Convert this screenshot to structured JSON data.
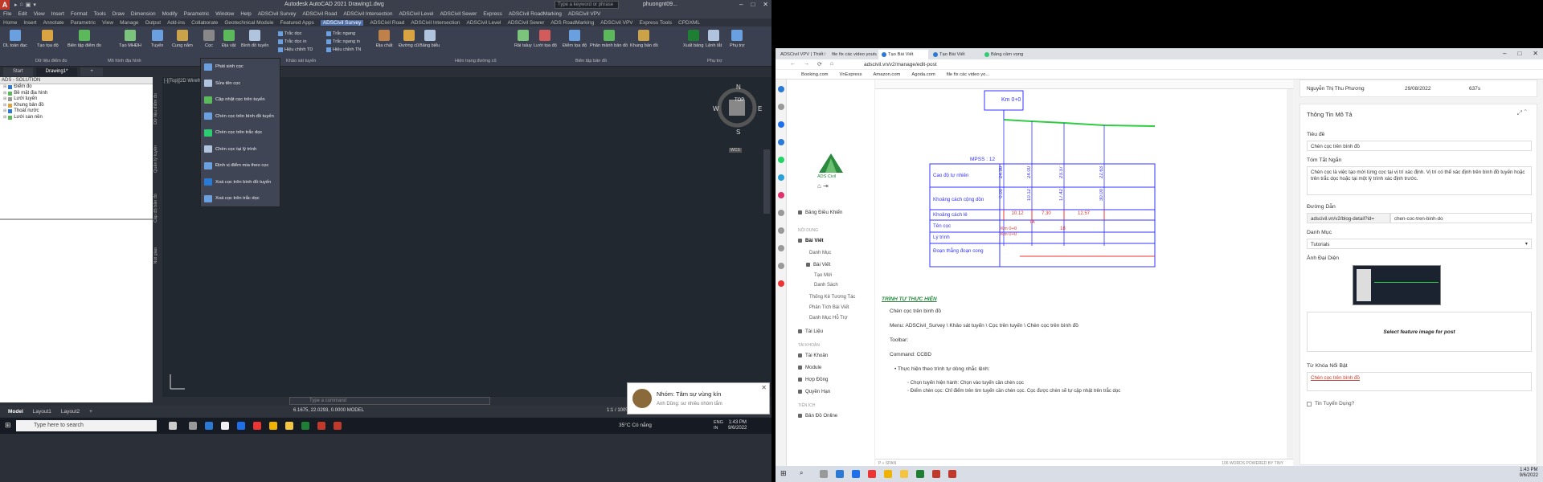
{
  "acad": {
    "qat": [
      "▸",
      "⌂",
      "▣",
      "▾"
    ],
    "window_title": "Autodesk AutoCAD 2021   Drawing1.dwg",
    "search_placeholder": "Type a keyword or phrase",
    "user": "phuongnt09...",
    "menubar": [
      "File",
      "Edit",
      "View",
      "Insert",
      "Format",
      "Tools",
      "Draw",
      "Dimension",
      "Modify",
      "Parametric",
      "Window",
      "Help",
      "ADSCivil Survey",
      "ADSCivil Road",
      "ADSCivil Intersection",
      "ADSCivil Level",
      "ADSCivil Sewer",
      "Express",
      "ADSCivil RoadMarking",
      "ADSCivil VPV"
    ],
    "tabs": [
      "Home",
      "Insert",
      "Annotate",
      "Parametric",
      "View",
      "Manage",
      "Output",
      "Add-ins",
      "Collaborate",
      "Geotechnical Module",
      "Featured Apps",
      "ADSCivil Survey",
      "ADSCivil Road",
      "ADSCivil Intersection",
      "ADSCivil Level",
      "ADSCivil Sewer",
      "ADS RoadMarking",
      "ADSCivil VPV",
      "Express Tools",
      "CPDXML"
    ],
    "active_tab": "ADSCivil Survey",
    "ribbon_buttons": [
      "DL toàn đạc",
      "Tạo tọa độ",
      "Biên tập điểm đo",
      "Tạo MHĐH",
      "Tuyến",
      "Cung nắm",
      "Cọc",
      "Địa vật",
      "Bình đồ tuyến",
      "Địa chất",
      "Đường cũ",
      "Bảng biểu",
      "Rải taluy",
      "Lưới tọa độ",
      "Điểm tọa độ",
      "Phân mảnh bản đồ",
      "Khung bản đồ",
      "Xuất bảng",
      "Lệnh tắt",
      "Phụ trợ"
    ],
    "ribbon_small": [
      "Trắc dọc",
      "Trắc dọc in",
      "Hiệu chỉnh TD",
      "Trắc ngang",
      "Trắc ngang in",
      "Hiệu chỉnh TN"
    ],
    "ribbon_panels": [
      "Dữ liệu điểm đo",
      "Mô hình địa hình",
      "Khảo sát tuyến",
      "Hiện trạng đường cũ",
      "Biên tập bản đồ",
      "Phụ trợ"
    ],
    "doc_tabs": [
      "Start",
      "Drawing1*"
    ],
    "panel_title": "ADS - SOLUTION",
    "tree": [
      "Điểm đo",
      "Bề mặt địa hình",
      "Lưới tuyến",
      "Khung bản đồ",
      "Thoát nước",
      "Lưới san nền"
    ],
    "vtabs": [
      "Dữ liệu điểm đo",
      "Quản lý tuyến",
      "Cấp độ bản đồ",
      "Nút giao"
    ],
    "viewport_label": "[-][Top][2D Wireframe]",
    "dropdown": [
      "Phát sinh cọc",
      "Sửa tên cọc",
      "Cập nhật cọc trên tuyến",
      "Chèn cọc trên bình đồ tuyến",
      "Chèn cọc trên trắc dọc",
      "Chèn cọc tại lý trình",
      "Định vị điểm mia theo cọc",
      "Xoá cọc trên bình đồ tuyến",
      "Xoá cọc trên trắc dọc"
    ],
    "compass": {
      "n": "N",
      "s": "S",
      "e": "E",
      "w": "W",
      "top": "TOP",
      "wcs": "WCS"
    },
    "cmd_placeholder": "Type a command",
    "layouts": [
      "Model",
      "Layout1",
      "Layout2"
    ],
    "coords": "6.1675, 22.0293, 0.0000   MODEL",
    "zoom": "1:1 / 100%",
    "notif_title": "Nhóm: Tâm sự vùng kín",
    "notif_sub": "Anh Dũng: sư nhiều nhóm tắm"
  },
  "taskbar": {
    "search": "Type here to search",
    "weather": "35°C  Có nắng",
    "lang": "ENG\nIN",
    "time": "1:43 PM",
    "date": "9/6/2022"
  },
  "browser": {
    "tabs": [
      "ADSCivil VPV | Thiết kế an...",
      "file fix các video youtube",
      "Tạo Bài Viết",
      "Tạo Bài Viết",
      "Bảng cầm vọng"
    ],
    "active_tab": 2,
    "url": "adscivil.vn/v2/manage/edit-post",
    "bookmarks": [
      "Booking.com",
      "VnExpress",
      "Amazon.com",
      "Agoda.com",
      "file fix các video yo..."
    ],
    "nav": {
      "brand": "ADS Civil",
      "dashboard": "Bảng Điều Khiển",
      "sec_content": "NỘI DUNG",
      "posts": "Bài Viết",
      "category": "Danh Mục",
      "posts_sub": "Bài Viết",
      "new": "Tạo Mới",
      "list": "Danh Sách",
      "stats": "Thống Kê Tương Tác",
      "analysis": "Phân Tích Bài Viết",
      "support": "Danh Mục Hỗ Trợ",
      "docs": "Tài Liệu",
      "sec_account": "TÀI KHOẢN",
      "account": "Tài Khoản",
      "module": "Module",
      "contract": "Hợp Đồng",
      "permission": "Quyền Hạn",
      "sec_util": "TIỆN ÍCH",
      "online_map": "Bản Đồ Online"
    },
    "diagram": {
      "km_top": "Km 0+0",
      "mpss": "MPSS : 12",
      "rows": [
        "Cao độ tự nhiên",
        "Khoảng cách cộng dồn",
        "Khoảng cách lẻ",
        "Tên cọc",
        "Lý trình",
        "Đoạn thẳng đoạn cong"
      ],
      "elev": [
        "24.36",
        "24.00",
        "23.37",
        "22.63"
      ],
      "cum": [
        "0.00",
        "10.12",
        "17.42",
        "30.00"
      ],
      "dist": [
        "10.12",
        "7.30",
        "12.57"
      ],
      "pile": [
        "TA",
        "18"
      ],
      "chain": [
        "Km 0+0",
        "Km 0+0"
      ]
    },
    "doc": {
      "heading": "TRÌNH TỰ THỰC HIỆN",
      "l1": "Chèn cọc trên bình đồ",
      "l2": "Menu: ADSCivil_Survey \\ Khảo sát tuyến \\ Cọc trên tuyến \\ Chèn cọc trên bình đồ",
      "l3": "Toolbar:",
      "l4": "Command: CCBD",
      "b1": "Thực hiện theo trình tự dòng nhắc lệnh:",
      "b2": "Chọn tuyến hiện hành: Chọn vào tuyến cần chèn cọc",
      "b3": "Điểm chèn cọc: Chỉ điểm trên tim tuyến cần chèn cọc. Cọc được chèn sẽ tự cập nhật trên trắc dọc",
      "status_left": "P » SPAN",
      "status_right": "106 WORDS  POWERED BY TINY"
    },
    "right": {
      "author": "Nguyễn Thị Thu Phương",
      "date": "29/08/2022",
      "views": "637s",
      "card_title": "Thông Tin Mô Tả",
      "title_label": "Tiêu đề",
      "title_val": "Chèn cọc trên bình đồ",
      "summary_label": "Tóm Tắt Ngắn",
      "summary_val": "Chèn cọc là việc tạo mới từng cọc tại vị trí xác định. Vị trí có thể xác định trên bình đồ tuyến hoặc trên trắc dọc hoặc tại một lý trình xác định trước.",
      "path_label": "Đường Dẫn",
      "path_prefix": "adscivil.vn/v2/blog-detail?id=",
      "path_slug": "chen-coc-tren-binh-do",
      "cat_label": "Danh Mục",
      "cat_val": "Tutorials",
      "img_label": "Ảnh Đại Diện",
      "img_btn": "Select feature image for post",
      "kw_label": "Từ Khóa Nổi Bật",
      "kw_val": "Chèn cọc trên bình đồ",
      "rec_label": "Tin Tuyển Dụng?"
    },
    "time": "1:43 PM",
    "date": "9/6/2022"
  },
  "colors": {
    "acad_bg": "#2b2f37",
    "canvas": "#212830",
    "accent": "#4f6fa8",
    "green": "#2b8a3e",
    "red": "#c0392b"
  }
}
